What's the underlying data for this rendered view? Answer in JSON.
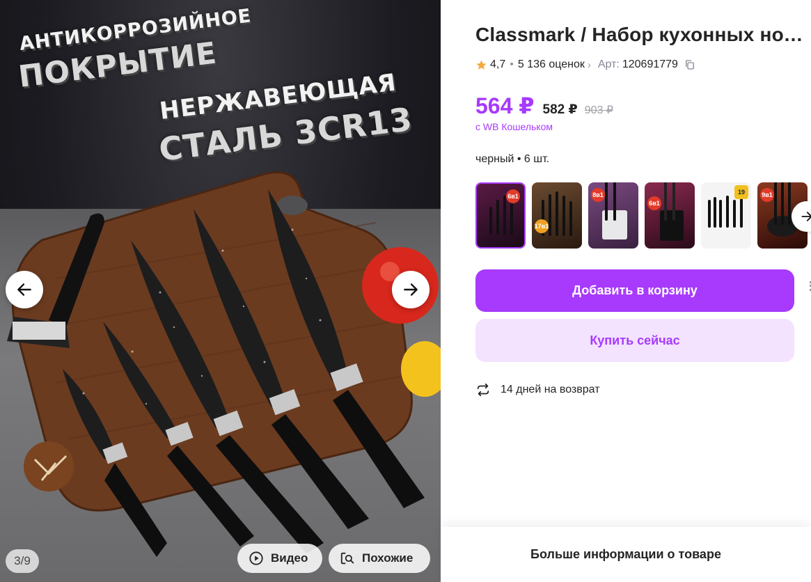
{
  "gallery": {
    "headline_line1": "АНТИКОРРОЗИЙНОЕ",
    "headline_line2": "ПОКРЫТИЕ",
    "headline_line3": "НЕРЖАВЕЮЩАЯ",
    "headline_line4": "СТАЛЬ 3CR13",
    "counter": "3/9",
    "video_label": "Видео",
    "similar_label": "Похожие",
    "prev_icon": "arrow-left-icon",
    "next_icon": "arrow-right-icon"
  },
  "product": {
    "title": "Classmark / Набор кухонных ножей",
    "rating": "4,7",
    "reviews": "5 136 оценок",
    "article_label": "Арт:",
    "article_value": "120691779",
    "price_main": "564 ₽",
    "price_mid": "582 ₽",
    "price_old": "903 ₽",
    "wallet_note": "с WB Кошельком",
    "variant": "черный • 6 шт.",
    "thumbnails": [
      {
        "badge": "6в1",
        "bg": "#3a1a30"
      },
      {
        "badge": "17в1",
        "bg": "#4a3322"
      },
      {
        "badge": "8в1",
        "bg": "#5a3a60"
      },
      {
        "badge": "6в1",
        "bg": "#502038"
      },
      {
        "badge": "19",
        "bg": "#f2f2f2"
      },
      {
        "badge": "9в1",
        "bg": "#602a20"
      }
    ],
    "add_to_cart": "Добавить в корзину",
    "buy_now": "Купить сейчас",
    "return_policy": "14 дней на возврат",
    "more_info": "Больше информации о товаре"
  },
  "colors": {
    "accent": "#a73afd",
    "accent_light": "#f3e3ff",
    "star": "#f6a93b"
  }
}
